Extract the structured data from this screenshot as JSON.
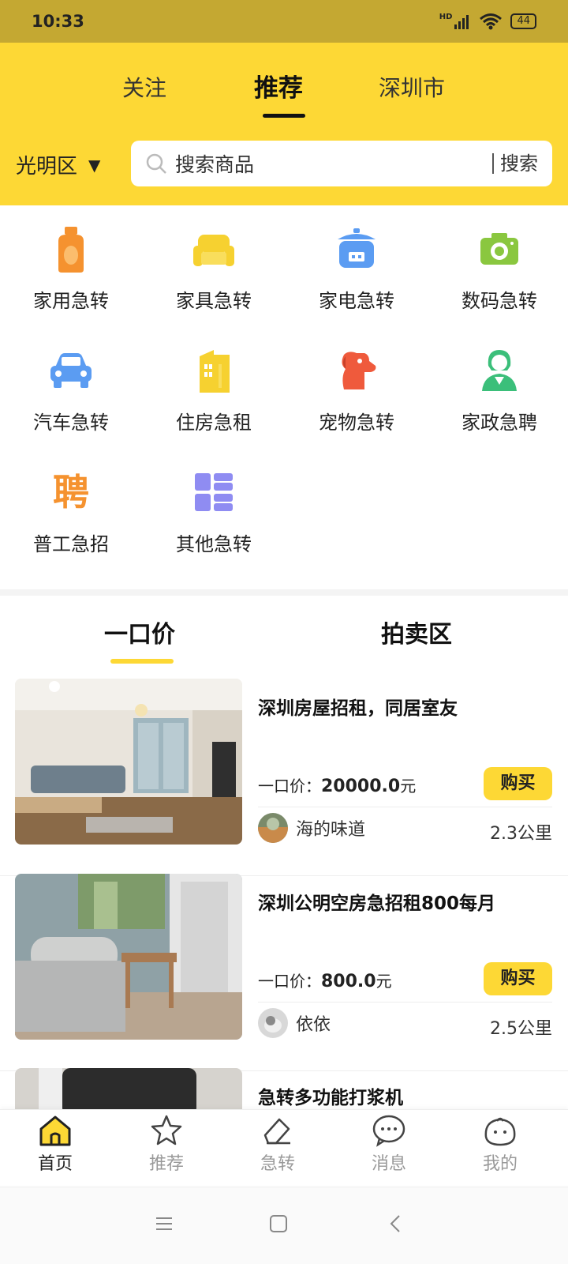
{
  "status": {
    "time": "10:33",
    "network": "HD",
    "battery": "44"
  },
  "header": {
    "tabs": [
      {
        "label": "关注"
      },
      {
        "label": "推荐"
      },
      {
        "label": "深圳市"
      }
    ],
    "district": "光明区",
    "search": {
      "placeholder": "搜索商品",
      "button": "搜索"
    }
  },
  "categories": [
    {
      "label": "家用急转",
      "icon": "detergent-bottle-icon",
      "color": "#f5922f"
    },
    {
      "label": "家具急转",
      "icon": "sofa-icon",
      "color": "#f6d130"
    },
    {
      "label": "家电急转",
      "icon": "rice-cooker-icon",
      "color": "#5b9cf2"
    },
    {
      "label": "数码急转",
      "icon": "camera-icon",
      "color": "#8ac73f"
    },
    {
      "label": "汽车急转",
      "icon": "car-icon",
      "color": "#5b9cf2"
    },
    {
      "label": "住房急租",
      "icon": "building-icon",
      "color": "#f6d130"
    },
    {
      "label": "宠物急转",
      "icon": "dog-icon",
      "color": "#ef5a3c"
    },
    {
      "label": "家政急聘",
      "icon": "housekeeper-icon",
      "color": "#3bbf7a"
    },
    {
      "label": "普工急招",
      "icon": "hire-icon",
      "color": "#f5922f",
      "glyph": "聘"
    },
    {
      "label": "其他急转",
      "icon": "grid-icon",
      "color": "#8f8cf2"
    }
  ],
  "deal_tabs": [
    {
      "label": "一口价"
    },
    {
      "label": "拍卖区"
    }
  ],
  "listings": [
    {
      "title": "深圳房屋招租，同居室友",
      "price_label": "一口价：",
      "price": "20000.0",
      "unit": "元",
      "buy": "购买",
      "seller": "海的味道",
      "distance": "2.3公里"
    },
    {
      "title": "深圳公明空房急招租800每月",
      "price_label": "一口价：",
      "price": "800.0",
      "unit": "元",
      "buy": "购买",
      "seller": "依依",
      "distance": "2.5公里"
    },
    {
      "title": "急转多功能打浆机"
    }
  ],
  "bottom_nav": [
    {
      "label": "首页",
      "icon": "home-icon"
    },
    {
      "label": "推荐",
      "icon": "star-icon"
    },
    {
      "label": "急转",
      "icon": "eraser-icon"
    },
    {
      "label": "消息",
      "icon": "message-icon"
    },
    {
      "label": "我的",
      "icon": "profile-icon"
    }
  ],
  "colors": {
    "brand": "#fdd835",
    "statusbar": "#c4a832"
  }
}
